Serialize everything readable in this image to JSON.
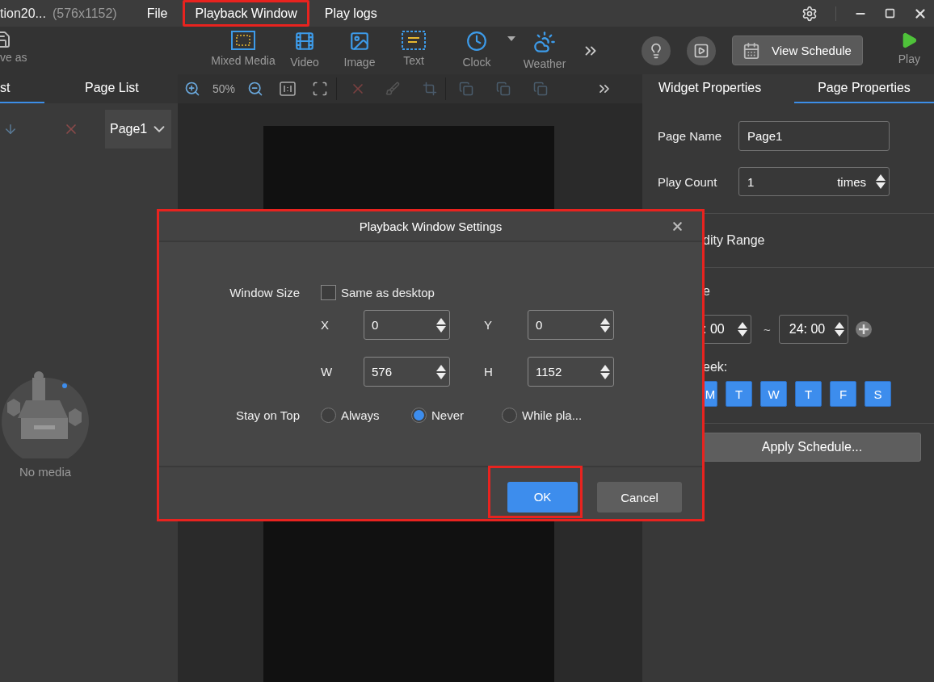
{
  "title_bar": {
    "title": "tion20...",
    "resolution": "(576x1152)",
    "menu": [
      {
        "label": "File",
        "highlighted": false
      },
      {
        "label": "Playback Window",
        "highlighted": true
      },
      {
        "label": "Play logs",
        "highlighted": false
      }
    ]
  },
  "toolbar": {
    "save_as": "ve as",
    "tools": [
      {
        "label": "Mixed Media",
        "kind": "mixed"
      },
      {
        "label": "Video",
        "kind": "video"
      },
      {
        "label": "Image",
        "kind": "image"
      },
      {
        "label": "Text",
        "kind": "text"
      },
      {
        "label": "Clock",
        "kind": "clock"
      },
      {
        "label": "Weather",
        "kind": "weather"
      }
    ],
    "view_schedule": "View Schedule",
    "play": "Play"
  },
  "left_panel": {
    "tabs": [
      {
        "label": "st",
        "selected": true
      },
      {
        "label": "Page List",
        "selected": false
      }
    ],
    "page_select": "Page1",
    "empty_text": "No media"
  },
  "canvas_toolbar": {
    "zoom": "50%"
  },
  "right_panel": {
    "tabs": [
      {
        "label": "Widget Properties",
        "selected": false
      },
      {
        "label": "Page Properties",
        "selected": true
      }
    ],
    "page_name": {
      "label": "Page Name",
      "value": "Page1"
    },
    "play_count": {
      "label": "Play Count",
      "value": "1",
      "unit": "times"
    },
    "validity": "dity Range",
    "time_section": "e",
    "start_time": ": 00",
    "tilde": "~",
    "end_time": "24: 00",
    "week_label": "eek:",
    "days": [
      {
        "label": "M",
        "selected": true
      },
      {
        "label": "T",
        "selected": true
      },
      {
        "label": "W",
        "selected": true
      },
      {
        "label": "T",
        "selected": true
      },
      {
        "label": "F",
        "selected": true
      },
      {
        "label": "S",
        "selected": true
      }
    ],
    "apply": "Apply Schedule..."
  },
  "dialog": {
    "title": "Playback Window Settings",
    "highlighted": true,
    "window_size_label": "Window Size",
    "same_as_desktop": {
      "label": "Same as desktop",
      "checked": false
    },
    "fields": [
      {
        "label": "X",
        "value": "0"
      },
      {
        "label": "Y",
        "value": "0"
      },
      {
        "label": "W",
        "value": "576"
      },
      {
        "label": "H",
        "value": "1152"
      }
    ],
    "stay_on_top": {
      "label": "Stay on Top",
      "options": [
        {
          "label": "Always",
          "selected": false
        },
        {
          "label": "Never",
          "selected": true
        },
        {
          "label": "While pla...",
          "selected": false
        }
      ]
    },
    "ok": {
      "label": "OK",
      "highlighted": true
    },
    "cancel": "Cancel"
  }
}
